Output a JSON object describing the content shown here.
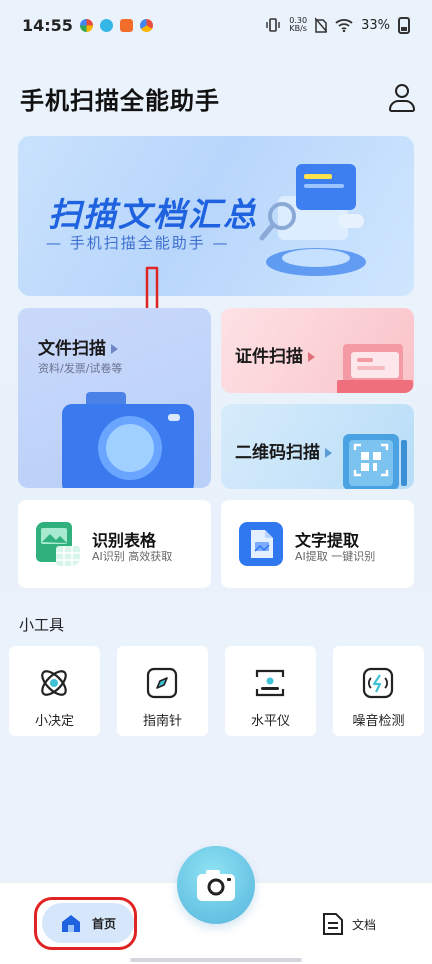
{
  "status_bar": {
    "time": "14:55",
    "speed_top": "0.30",
    "speed_bottom": "KB/s",
    "battery": "33%"
  },
  "header": {
    "title": "手机扫描全能助手"
  },
  "banner": {
    "title": "扫描文档汇总",
    "subtitle": "— 手机扫描全能助手 —"
  },
  "feature_cards": {
    "file_scan": {
      "label": "文件扫描",
      "sub": "资料/发票/试卷等"
    },
    "cert_scan": {
      "label": "证件扫描"
    },
    "qr_scan": {
      "label": "二维码扫描"
    }
  },
  "quick_cards": [
    {
      "title": "识别表格",
      "sub": "AI识别 高效获取"
    },
    {
      "title": "文字提取",
      "sub": "AI提取 一键识别"
    }
  ],
  "tools_section": {
    "title": "小工具",
    "items": [
      {
        "label": "小决定",
        "icon": "atom-icon"
      },
      {
        "label": "指南针",
        "icon": "compass-icon"
      },
      {
        "label": "水平仪",
        "icon": "level-icon"
      },
      {
        "label": "噪音检测",
        "icon": "noise-icon"
      }
    ]
  },
  "tabbar": {
    "home": "首页",
    "docs": "文档"
  },
  "colors": {
    "accent_blue": "#1f62e0",
    "annotation_red": "#e02424"
  }
}
